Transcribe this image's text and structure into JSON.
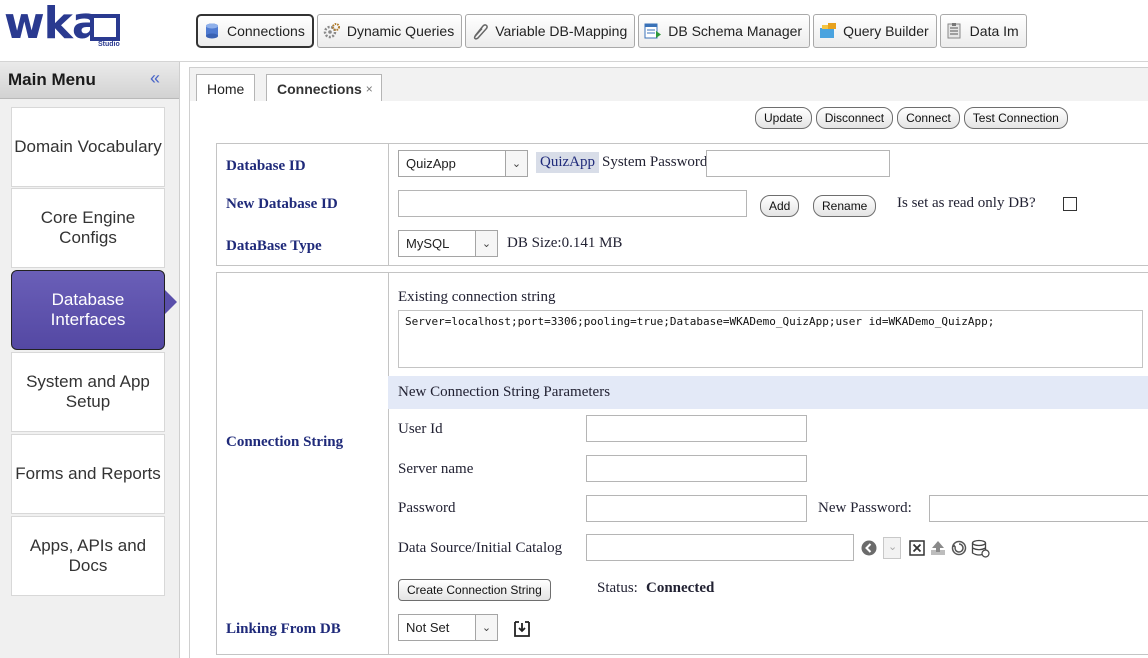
{
  "logo": {
    "text": "wka",
    "sub": "Studio"
  },
  "toolbar": {
    "items": [
      {
        "label": "Connections",
        "icon": "database-icon"
      },
      {
        "label": "Dynamic Queries",
        "icon": "gears-icon"
      },
      {
        "label": "Variable DB-Mapping",
        "icon": "paperclip-icon"
      },
      {
        "label": "DB Schema Manager",
        "icon": "schema-icon"
      },
      {
        "label": "Query Builder",
        "icon": "query-builder-icon"
      },
      {
        "label": "Data Im",
        "icon": "data-import-icon"
      }
    ]
  },
  "menu": {
    "title": "Main Menu",
    "collapse": "«",
    "items": [
      {
        "label": "Domain Vocabulary"
      },
      {
        "label": "Core Engine Configs"
      },
      {
        "label": "Database Interfaces"
      },
      {
        "label": "System and App Setup"
      },
      {
        "label": "Forms and Reports"
      },
      {
        "label": "Apps, APIs and Docs"
      }
    ]
  },
  "tabs": {
    "home": "Home",
    "connections": "Connections",
    "close": "×"
  },
  "actions": {
    "update": "Update",
    "disconnect": "Disconnect",
    "connect": "Connect",
    "test": "Test Connection"
  },
  "db": {
    "id_label": "Database ID",
    "id_value": "QuizApp",
    "id_chip": "QuizApp",
    "system_password_label": "System Password",
    "new_id_label": "New Database ID",
    "add": "Add",
    "rename": "Rename",
    "readonly_label": "Is set as read only DB?",
    "type_label": "DataBase Type",
    "type_value": "MySQL",
    "size": "DB Size:0.141 MB"
  },
  "conn": {
    "section_label": "Connection String",
    "existing_label": "Existing connection string",
    "existing_value": "Server=localhost;port=3306;pooling=true;Database=WKADemo_QuizApp;user id=WKADemo_QuizApp;",
    "new_params_label": "New Connection String Parameters",
    "user_id": "User Id",
    "server_name": "Server name",
    "password": "Password",
    "new_password": "New Password:",
    "data_source": "Data Source/Initial Catalog",
    "create": "Create Connection String",
    "status_label": "Status:",
    "status_value": "Connected",
    "linking_label": "Linking From DB",
    "linking_value": "Not Set"
  },
  "colors": {
    "menu_active": "#5a4fab",
    "label_blue": "#1f2a7a",
    "params_bar": "#e3e9f7"
  }
}
